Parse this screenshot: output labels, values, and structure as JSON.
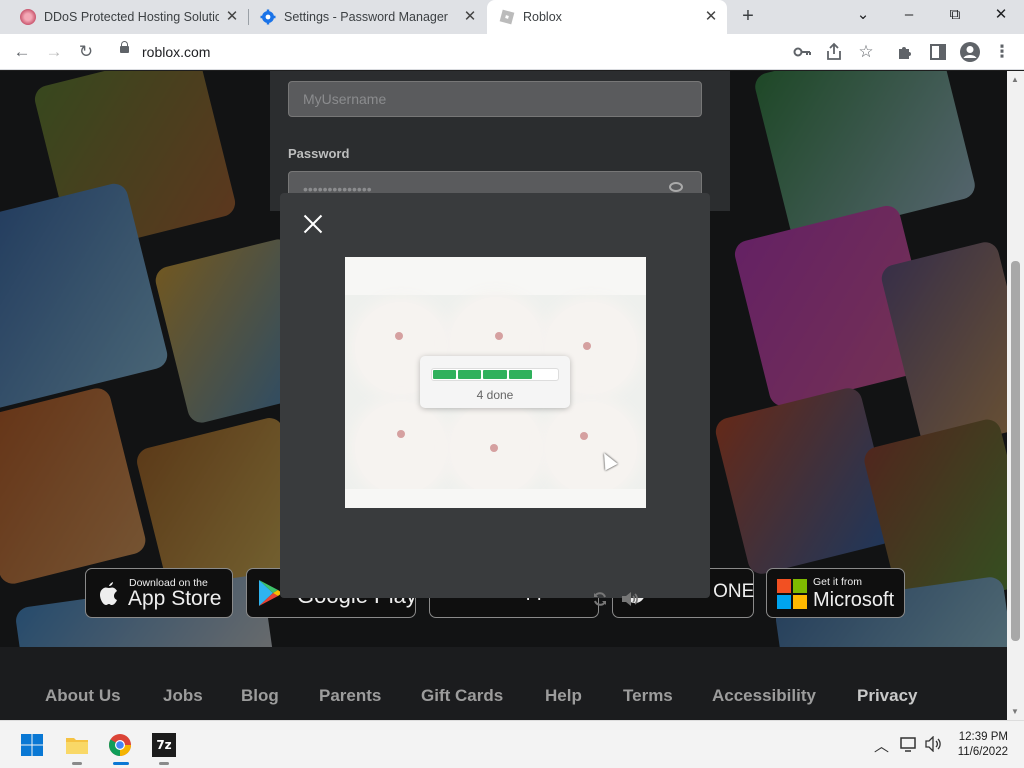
{
  "browser": {
    "tabs": [
      {
        "title": "DDoS Protected Hosting Solution",
        "favicon": "flower-favicon",
        "active": false
      },
      {
        "title": "Settings - Password Manager",
        "favicon": "gear-icon",
        "active": false
      },
      {
        "title": "Roblox",
        "favicon": "roblox-icon",
        "active": true
      }
    ],
    "url": "roblox.com",
    "window_controls": {
      "minimize": "–",
      "maximize": "⧉",
      "close": "✕",
      "tab_search": "⌄"
    }
  },
  "login": {
    "username_value": "MyUsername",
    "password_label": "Password",
    "password_value": "••••••••••••••"
  },
  "captcha": {
    "progress_text": "4 done",
    "segments_total": 5,
    "segments_done": 4,
    "progress_color": "#2fb15c"
  },
  "store_badges": [
    {
      "small": "Download on the",
      "big": "App Store"
    },
    {
      "small": "",
      "big": "Google Play"
    },
    {
      "small": "",
      "big": "amazon appstore"
    },
    {
      "small": "",
      "big": "XBOX ONE"
    },
    {
      "small": "Get it from",
      "big": "Microsoft"
    }
  ],
  "footer": {
    "links": [
      "About Us",
      "Jobs",
      "Blog",
      "Parents",
      "Gift Cards",
      "Help",
      "Terms",
      "Accessibility",
      "Privacy"
    ]
  },
  "taskbar": {
    "time": "12:39 PM",
    "date": "11/6/2022",
    "apps": [
      "windows-start",
      "file-explorer",
      "chrome",
      "7zip"
    ],
    "sevenzip_label": "7z"
  }
}
